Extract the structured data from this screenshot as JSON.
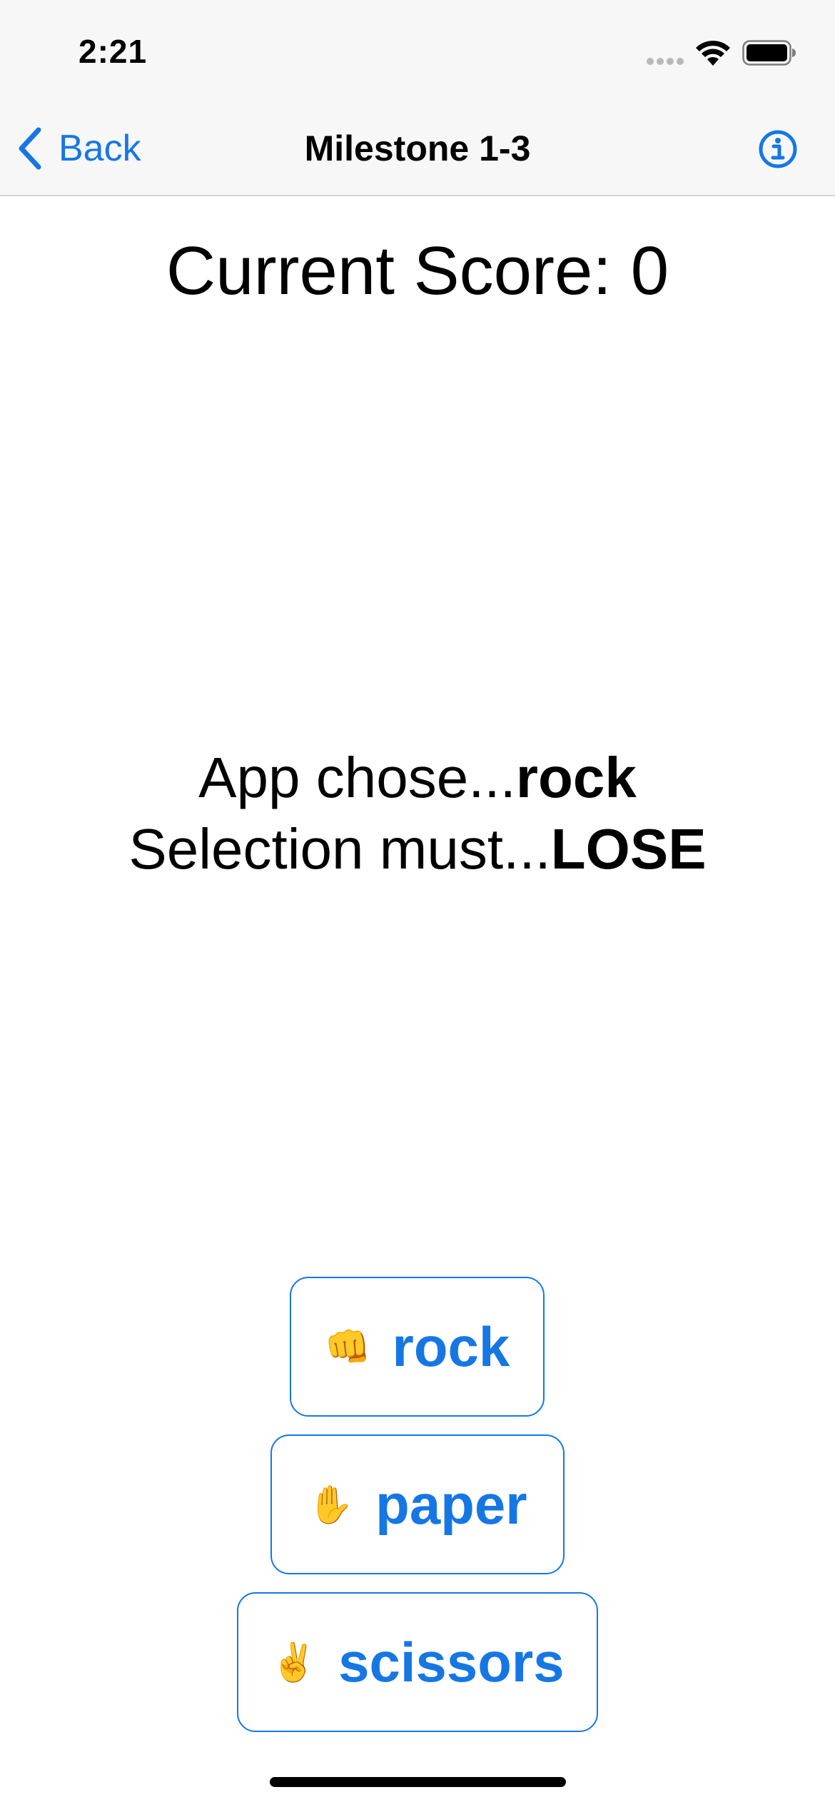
{
  "status_bar": {
    "time": "2:21",
    "icons": [
      "cellular-signal-icon",
      "wifi-icon",
      "battery-icon"
    ]
  },
  "nav": {
    "back_label": "Back",
    "title": "Milestone 1-3",
    "info_icon": "info-icon"
  },
  "score": {
    "text": "Current Score: 0"
  },
  "prompt": {
    "app_chose_prefix": "App chose...",
    "app_choice": "rock",
    "selection_prefix": "Selection must...",
    "selection_goal": "LOSE"
  },
  "choices": [
    {
      "emoji": "👊",
      "label": "rock"
    },
    {
      "emoji": "✋",
      "label": "paper"
    },
    {
      "emoji": "✌️",
      "label": "scissors"
    }
  ],
  "colors": {
    "accent": "#1677e4",
    "bar_background": "#f7f7f7",
    "text": "#000000"
  }
}
